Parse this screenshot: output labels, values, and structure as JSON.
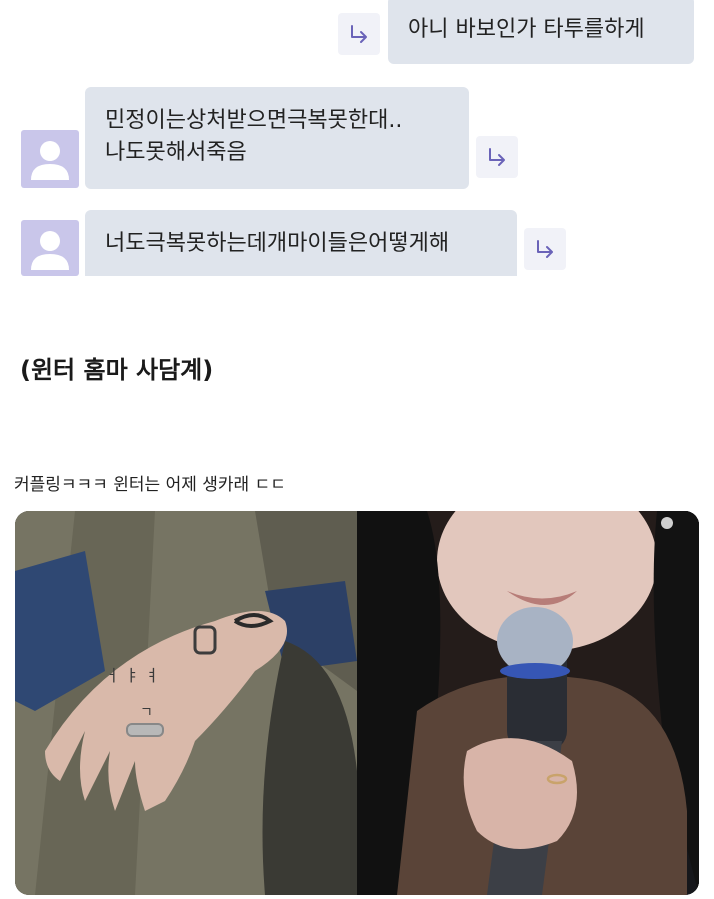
{
  "chat": {
    "msg_sent_1": "아니 바보인가 타투를하게",
    "msg_recv_1_line1": "민정이는상처받으면극복못한대..",
    "msg_recv_1_line2": "나도못해서죽음",
    "msg_recv_2": "너도극복못하는데개마이들은어떻게해",
    "reply_icon": "reply-arrow-icon",
    "avatar_icon": "default-user-avatar-icon"
  },
  "post": {
    "heading": "(윈터 홈마 사담계)",
    "caption": "커플링ㅋㅋㅋ 윈터는 어제 생카래 ㄷㄷ"
  },
  "photos": {
    "left": "hand-with-tattoos-and-ring-photo",
    "right": "singer-with-microphone-ring-photo"
  },
  "colors": {
    "bubble": "#dfe4ec",
    "avatar_bg": "#c9c6ea",
    "reply_arrow": "#6a63b8"
  }
}
